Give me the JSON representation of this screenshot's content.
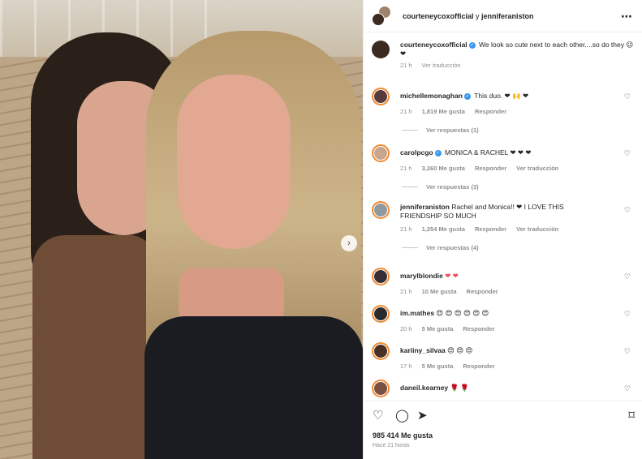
{
  "header": {
    "user1": "courteneycoxofficial",
    "separator": " y ",
    "user2": "jenniferaniston",
    "more_icon": "⋯"
  },
  "caption": {
    "username": "courteneycoxofficial",
    "text": "We look so cute next to each other....so do they 😉 ❤",
    "time": "21 h",
    "translate": "Ver traducción"
  },
  "comments": [
    {
      "username": "michellemonaghan",
      "verified": true,
      "text": "This duo. ❤ 🙌 ❤",
      "time": "21 h",
      "likes": "1,819 Me gusta",
      "reply": "Responder",
      "translate": "",
      "replies": "Ver respuestas (1)",
      "avatar_color": "#5a3b3b"
    },
    {
      "username": "carolpcgo",
      "verified": true,
      "text": "MONICA & RACHEL ❤ ❤ ❤",
      "time": "21 h",
      "likes": "3,260 Me gusta",
      "reply": "Responder",
      "translate": "Ver traducción",
      "replies": "Ver respuestas (3)",
      "avatar_color": "#c9a58f"
    },
    {
      "username": "jenniferaniston",
      "verified": false,
      "text": "Rachel and Monica!! ❤ I LOVE THIS FRIENDSHIP SO MUCH",
      "time": "21 h",
      "likes": "1,254 Me gusta",
      "reply": "Responder",
      "translate": "Ver traducción",
      "replies": "Ver respuestas (4)",
      "avatar_color": "#8f9aa0"
    },
    {
      "username": "marylblondie",
      "verified": false,
      "text": "❤ ❤",
      "time": "21 h",
      "likes": "10 Me gusta",
      "reply": "Responder",
      "translate": "",
      "replies": "",
      "avatar_color": "#3a2e36"
    },
    {
      "username": "im.mathes",
      "verified": false,
      "text": "😍 😍 😍 😍 😍 😍",
      "time": "20 h",
      "likes": "5 Me gusta",
      "reply": "Responder",
      "translate": "",
      "replies": "",
      "avatar_color": "#2b2b2b"
    },
    {
      "username": "kariiny_silvaa",
      "verified": false,
      "text": "😍 😍 😍",
      "time": "17 h",
      "likes": "5 Me gusta",
      "reply": "Responder",
      "translate": "",
      "replies": "",
      "avatar_color": "#4a3024"
    },
    {
      "username": "daneil.kearney",
      "verified": false,
      "text": "🌹 🌹",
      "time": "",
      "likes": "",
      "reply": "",
      "translate": "",
      "replies": "",
      "avatar_color": "#7a5040"
    }
  ],
  "actions": {
    "like_icon": "♡",
    "comment_icon": "◯",
    "share_icon": "➤",
    "save_icon": "⌑",
    "likes": "985 414 Me gusta",
    "ago": "Hace 21 horas"
  },
  "photo": {
    "next_icon": "›"
  }
}
